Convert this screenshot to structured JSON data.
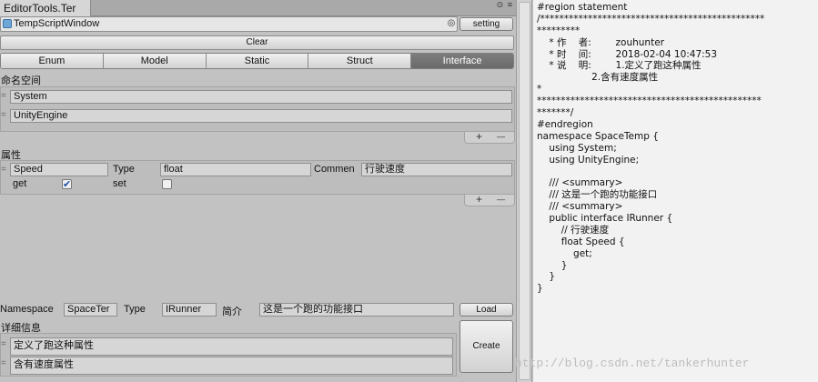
{
  "editor": {
    "tab_title": "EditorTools.Ter",
    "tab_controls": [
      "⊙",
      "≡"
    ],
    "window_name": "TempScriptWindow",
    "setting_label": "setting",
    "clear_label": "Clear",
    "type_tabs": [
      "Enum",
      "Model",
      "Static",
      "Struct",
      "Interface"
    ],
    "active_type": "Interface",
    "namespaces": {
      "label": "命名空间",
      "items": [
        "System",
        "UnityEngine"
      ]
    },
    "properties": {
      "label": "属性",
      "name": "Speed",
      "type_label": "Type",
      "type_value": "float",
      "comment_label": "Commen",
      "comment_value": "行驶速度",
      "get_label": "get",
      "get_checked": true,
      "set_label": "set",
      "set_checked": false
    },
    "footer": {
      "namespace_label": "Namespace",
      "namespace_value": "SpaceTer",
      "type_label": "Type",
      "type_value": "IRunner",
      "summary_label": "简介",
      "summary_value": "这是一个跑的功能接口",
      "load_label": "Load",
      "create_label": "Create"
    },
    "details": {
      "label": "详细信息",
      "items": [
        "定义了跑这种属性",
        "含有速度属性"
      ]
    },
    "plus_glyph": "+",
    "minus_glyph": "—",
    "drag_glyph": "="
  },
  "code": {
    "lines": [
      "#region statement",
      "/***********************************************",
      "*********",
      "    * 作    者:        zouhunter",
      "    * 时    间:        2018-02-04 10:47:53",
      "    * 说    明:        1.定义了跑这种属性",
      "                  2.含有速度属性",
      "*",
      "***********************************************",
      "*******/",
      "#endregion",
      "namespace SpaceTemp {",
      "    using System;",
      "    using UnityEngine;",
      "",
      "    /// <summary>",
      "    /// 这是一个跑的功能接口",
      "    /// <summary>",
      "    public interface IRunner {",
      "        // 行驶速度",
      "        float Speed {",
      "            get;",
      "        }",
      "    }",
      "}"
    ],
    "watermark": "http://blog.csdn.net/tankerhunter"
  }
}
